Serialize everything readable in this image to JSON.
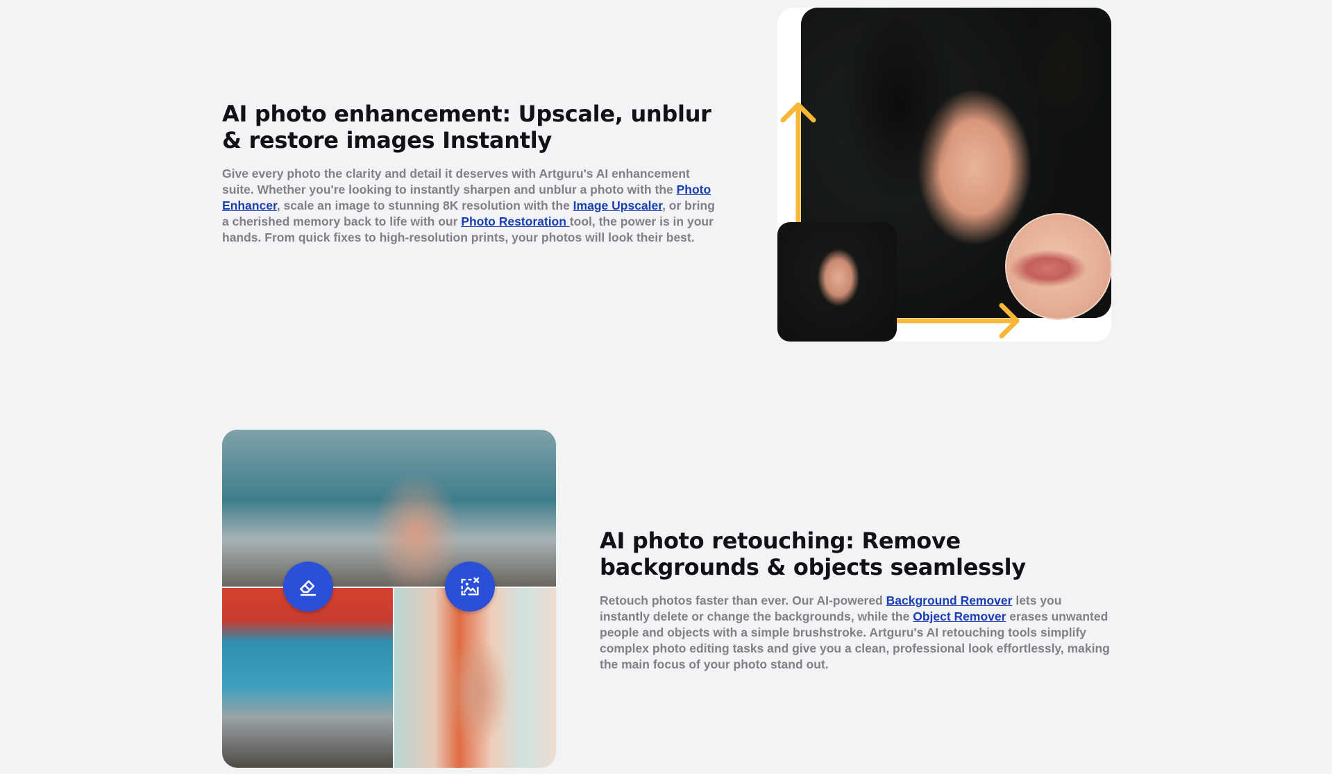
{
  "section1": {
    "title": "AI photo enhancement: Upscale, unblur & restore images Instantly",
    "body_1": "Give every photo the clarity and detail it deserves with Artguru's AI enhancement suite. Whether you're looking to instantly sharpen and unblur a photo with the ",
    "link_1": "Photo Enhancer",
    "body_2": ", scale an image to stunning 8K resolution with the ",
    "link_2": "Image Upscaler",
    "body_3": ", or bring a cherished memory back to life with our ",
    "link_3": "Photo Restoration ",
    "body_4": "tool, the power is in your hands. From quick fixes to high-resolution prints, your photos will look their best."
  },
  "section2": {
    "title": "AI photo retouching: Remove backgrounds & objects seamlessly",
    "body_1": "Retouch photos faster than ever. Our AI-powered ",
    "link_1": "Background Remover",
    "body_2": " lets you instantly delete or change the backgrounds, while the ",
    "link_2": "Object Remover",
    "body_3": " erases unwanted people and objects with a simple brushstroke. Artguru's AI retouching tools simplify complex photo editing tasks and give you a clean, professional look effortlessly, making the main focus of your photo stand out."
  },
  "icons": {
    "eraser": "eraser-icon",
    "object_remove": "image-remove-icon"
  },
  "colors": {
    "background": "#f2f3f5",
    "link": "#1a3fb4",
    "accent_arrow": "#f7b838",
    "badge": "#2b4fd8"
  }
}
